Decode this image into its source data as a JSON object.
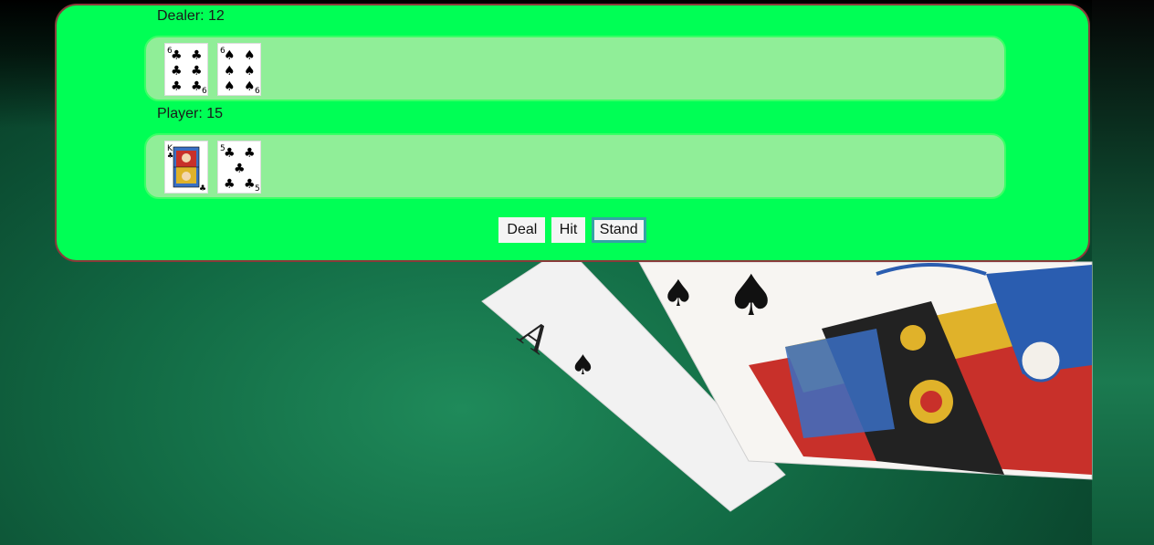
{
  "dealer": {
    "label": "Dealer: 12",
    "cards": [
      {
        "rank": "6",
        "suit": "clubs",
        "symbol": "♣",
        "color": "#000000"
      },
      {
        "rank": "6",
        "suit": "spades",
        "symbol": "♠",
        "color": "#000000"
      }
    ]
  },
  "player": {
    "label": "Player: 15",
    "cards": [
      {
        "rank": "K",
        "suit": "clubs",
        "symbol": "♣",
        "color": "#000000",
        "face": true
      },
      {
        "rank": "5",
        "suit": "clubs",
        "symbol": "♣",
        "color": "#000000"
      }
    ]
  },
  "controls": {
    "deal_label": "Deal",
    "hit_label": "Hit",
    "stand_label": "Stand"
  },
  "colors": {
    "panel": "#00ff55",
    "hand_area": "#90ee98",
    "panel_border": "#8a3a3a",
    "focus_ring": "#35a3a6"
  }
}
